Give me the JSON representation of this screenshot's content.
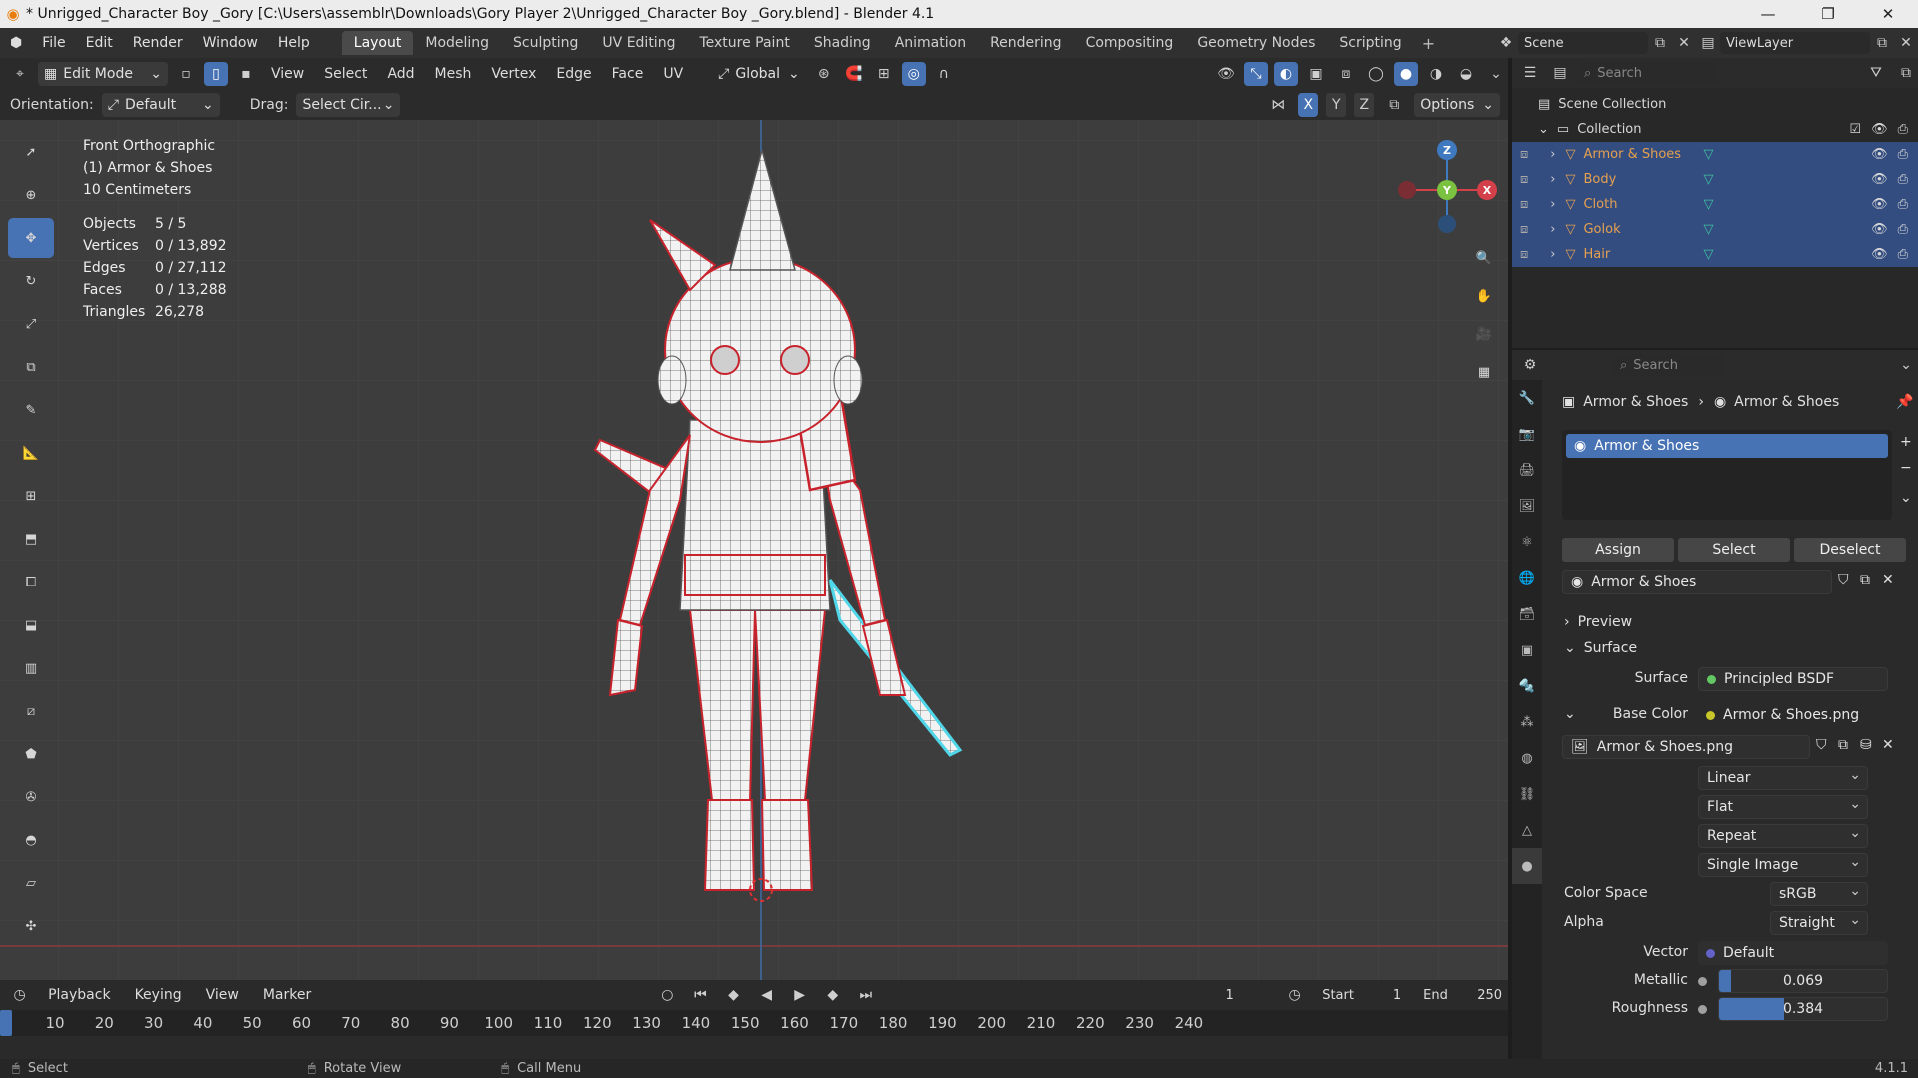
{
  "window": {
    "title": "* Unrigged_Character Boy _Gory [C:\\Users\\assemblr\\Downloads\\Gory Player 2\\Unrigged_Character Boy _Gory.blend] - Blender 4.1",
    "minimize": "—",
    "maximize": "❐",
    "close": "✕"
  },
  "menu": {
    "items": [
      "File",
      "Edit",
      "Render",
      "Window",
      "Help"
    ],
    "workspaces": [
      "Layout",
      "Modeling",
      "Sculpting",
      "UV Editing",
      "Texture Paint",
      "Shading",
      "Animation",
      "Rendering",
      "Compositing",
      "Geometry Nodes",
      "Scripting"
    ],
    "active_workspace": "Layout",
    "scene": "Scene",
    "view_layer": "ViewLayer"
  },
  "viewport_header": {
    "mode": "Edit Mode",
    "menus": [
      "View",
      "Select",
      "Add",
      "Mesh",
      "Vertex",
      "Edge",
      "Face",
      "UV"
    ],
    "transform_orientation": "Global"
  },
  "tool_header": {
    "orientation_label": "Orientation:",
    "orientation_value": "Default",
    "drag_label": "Drag:",
    "drag_value": "Select Cir...",
    "axes": [
      "X",
      "Y",
      "Z"
    ],
    "options": "Options"
  },
  "viewport": {
    "view_name": "Front Orthographic",
    "object_label": "(1) Armor & Shoes",
    "scale_label": "10 Centimeters",
    "stats": [
      {
        "label": "Objects",
        "value": "5 / 5"
      },
      {
        "label": "Vertices",
        "value": "0 / 13,892"
      },
      {
        "label": "Edges",
        "value": "0 / 27,112"
      },
      {
        "label": "Faces",
        "value": "0 / 13,288"
      },
      {
        "label": "Triangles",
        "value": "26,278"
      }
    ],
    "gizmo": {
      "z": "Z",
      "y": "Y",
      "x": "X"
    }
  },
  "timeline": {
    "menus": [
      "Playback",
      "Keying",
      "View",
      "Marker"
    ],
    "current_frame": "1",
    "start_label": "Start",
    "start": "1",
    "end_label": "End",
    "end": "250",
    "ticks": [
      "10",
      "20",
      "30",
      "40",
      "50",
      "60",
      "70",
      "80",
      "90",
      "100",
      "110",
      "120",
      "130",
      "140",
      "150",
      "160",
      "170",
      "180",
      "190",
      "200",
      "210",
      "220",
      "230",
      "240"
    ]
  },
  "outliner": {
    "search_placeholder": "Search",
    "scene_collection": "Scene Collection",
    "collection": "Collection",
    "objects": [
      "Armor & Shoes",
      "Body",
      "Cloth",
      "Golok",
      "Hair"
    ]
  },
  "properties": {
    "search_placeholder": "Search",
    "breadcrumb_object": "Armor & Shoes",
    "breadcrumb_material": "Armor & Shoes",
    "slot": "Armor & Shoes",
    "assign": "Assign",
    "select": "Select",
    "deselect": "Deselect",
    "material_name": "Armor & Shoes",
    "preview": "Preview",
    "surface_section": "Surface",
    "surface_label": "Surface",
    "surface_value": "Principled BSDF",
    "base_color_label": "Base Color",
    "base_color_value": "Armor & Shoes.png",
    "image_name": "Armor & Shoes.png",
    "interpolation": "Linear",
    "projection": "Flat",
    "extension": "Repeat",
    "source": "Single Image",
    "color_space_label": "Color Space",
    "color_space": "sRGB",
    "alpha_label": "Alpha",
    "alpha": "Straight",
    "vector_label": "Vector",
    "vector": "Default",
    "metallic_label": "Metallic",
    "metallic": "0.069",
    "metallic_fraction": 0.069,
    "roughness_label": "Roughness",
    "roughness": "0.384",
    "roughness_fraction": 0.384
  },
  "statusbar": {
    "select": "Select",
    "rotate": "Rotate View",
    "call_menu": "Call Menu",
    "version": "4.1.1"
  },
  "colors": {
    "accent": "#4772b3",
    "selected_row": "#334d80",
    "object_name": "#e5a050",
    "seam": "#c8232d",
    "outline": "#4fd6e8"
  }
}
